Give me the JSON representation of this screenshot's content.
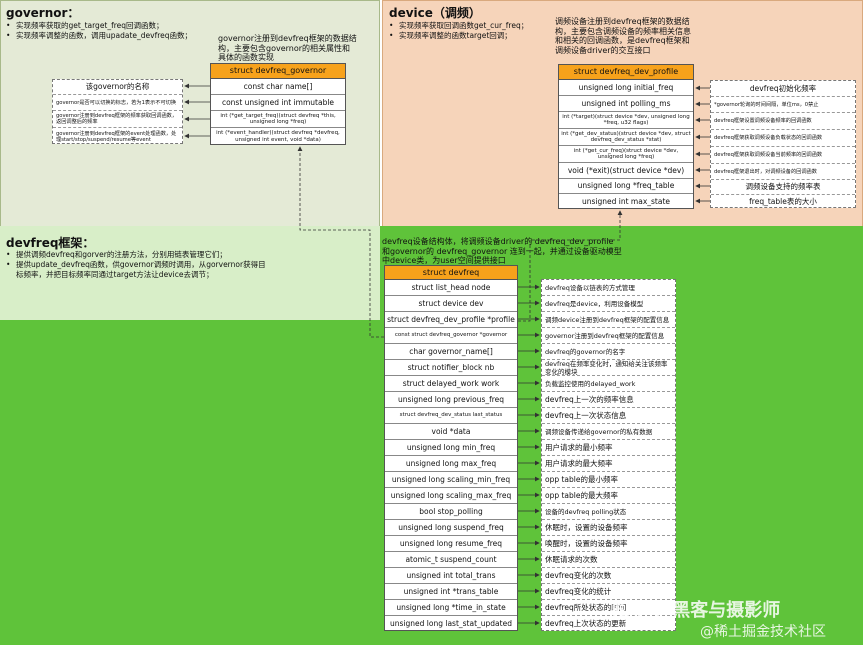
{
  "governor": {
    "title": "governor：",
    "bullets": [
      "实现频率获取的get_target_freq回调函数；",
      "实现频率调整的函数，调用upadate_devfreq函数；"
    ],
    "note": "governor注册到devfreq框架的数据结构，主要包含governor的相关属性和具体的函数实现",
    "struct_title": "struct devfreq_governor",
    "rows": [
      "const char name[]",
      "const unsigned int immutable",
      "int (*get_target_freq)(struct devfreq *this, unsigned long *freq)",
      "int (*event_handler)(struct devfreq *devfreq, unsigned int event, void *data)"
    ],
    "descs": [
      "该governor的名称",
      "governor是否可以切换的标志，若为1表示不可切换",
      "governor注册到devfreq框架的频率获取回调函数，返回调整后的频率",
      "governor注册到devfreq框架的event处理函数，处理start/stop/suspend/resume等event"
    ]
  },
  "device": {
    "title": "device（调频）",
    "bullets": [
      "实现频率获取回调函数get_cur_freq；",
      "实现频率调整的函数target回调；"
    ],
    "note": "调频设备注册到devfreq框架的数据结构，主要包含调频设备的频率相关信息和相关的回调函数，是devfreq框架和调频设备driver的交互接口",
    "struct_title": "struct devfreq_dev_profile",
    "rows": [
      "unsigned long initial_freq",
      "unsigned int polling_ms",
      "int (*target)(struct device *dev, unsigned long *freq, u32 flags)",
      "int (*get_dev_status)(struct device *dev, struct devfreq_dev_status *stat)",
      "int (*get_cur_freq)(struct device *dev, unsigned long *freq)",
      "void (*exit)(struct device *dev)",
      "unsigned long *freq_table",
      "unsigned int max_state"
    ],
    "descs": [
      "devfreq初始化频率",
      "*governor轮询的时间间隔，单位ms，0禁止",
      "devfreq框架设置调频设备频率的回调函数",
      "devfreq框架获取调频设备负载状态的回调函数",
      "devfreq框架获取调频设备当前频率的回调函数",
      "devfreq框架退出时，对调频设备的回调函数",
      "调频设备支持的频率表",
      "freq_table表的大小"
    ]
  },
  "framework": {
    "title": "devfreq框架：",
    "bullets": [
      "提供调频devfreq和gorver的注册方法，分别用链表管理它们；",
      "提供update_devfreq函数，供governor调频时调用，从gorvernor获得目标频率，并把目标频率同通过target方法让device去调节；"
    ],
    "note": "devfreq设备结构体，将调频设备driver的 devfreq_dev_profile 和governor的 devfreq_governor 连到一起，并通过设备驱动模型中device类，为user空间提供接口",
    "struct_title": "struct devfreq",
    "rows": [
      "struct list_head node",
      "struct device dev",
      "struct devfreq_dev_profile *profile",
      "const struct devfreq_governor *governor",
      "char governor_name[]",
      "struct notifier_block nb",
      "struct delayed_work work",
      "unsigned long previous_freq",
      "struct devfreq_dev_status last_status",
      "void *data",
      "unsigned long min_freq",
      "unsigned long max_freq",
      "unsigned long scaling_min_freq",
      "unsigned long scaling_max_freq",
      "bool stop_polling",
      "unsigned long suspend_freq",
      "unsigned long resume_freq",
      "atomic_t suspend_count",
      "unsigned int total_trans",
      "unsigned int *trans_table",
      "unsigned long *time_in_state",
      "unsigned long last_stat_updated"
    ],
    "descs": [
      "devfreq设备以链表的方式管理",
      "devfreq是device，利用设备模型",
      "调频device注册到devfreq框架的配置信息",
      "governor注册到devfreq框架的配置信息",
      "devfreq的governor的名字",
      "devfreq在频率变化时，通知给关注该频率变化的模块",
      "负载监控使用的delayed_work",
      "devfreq上一次的频率信息",
      "devfreq上一次状态信息",
      "调频设备传递给governor的私有数据",
      "用户请求的最小频率",
      "用户请求的最大频率",
      "opp table的最小频率",
      "opp table的最大频率",
      "设备的devfreq polling状态",
      "休眠时，设置的设备频率",
      "唤醒时，设置的设备频率",
      "休眠请求的次数",
      "devfreq变化的次数",
      "devfreq变化的统计",
      "devfreq所处状态的时间",
      "devfreq上次状态的更新"
    ]
  },
  "watermark": {
    "line1": "知乎 @黑客与摄影师",
    "line2": "@稀土掘金技术社区"
  },
  "colors": {
    "struct_header": "#f7a21b",
    "governor_bg": "#e4ead6",
    "device_bg": "#f6d4ba",
    "devfreq_bg": "#5fc33a"
  }
}
